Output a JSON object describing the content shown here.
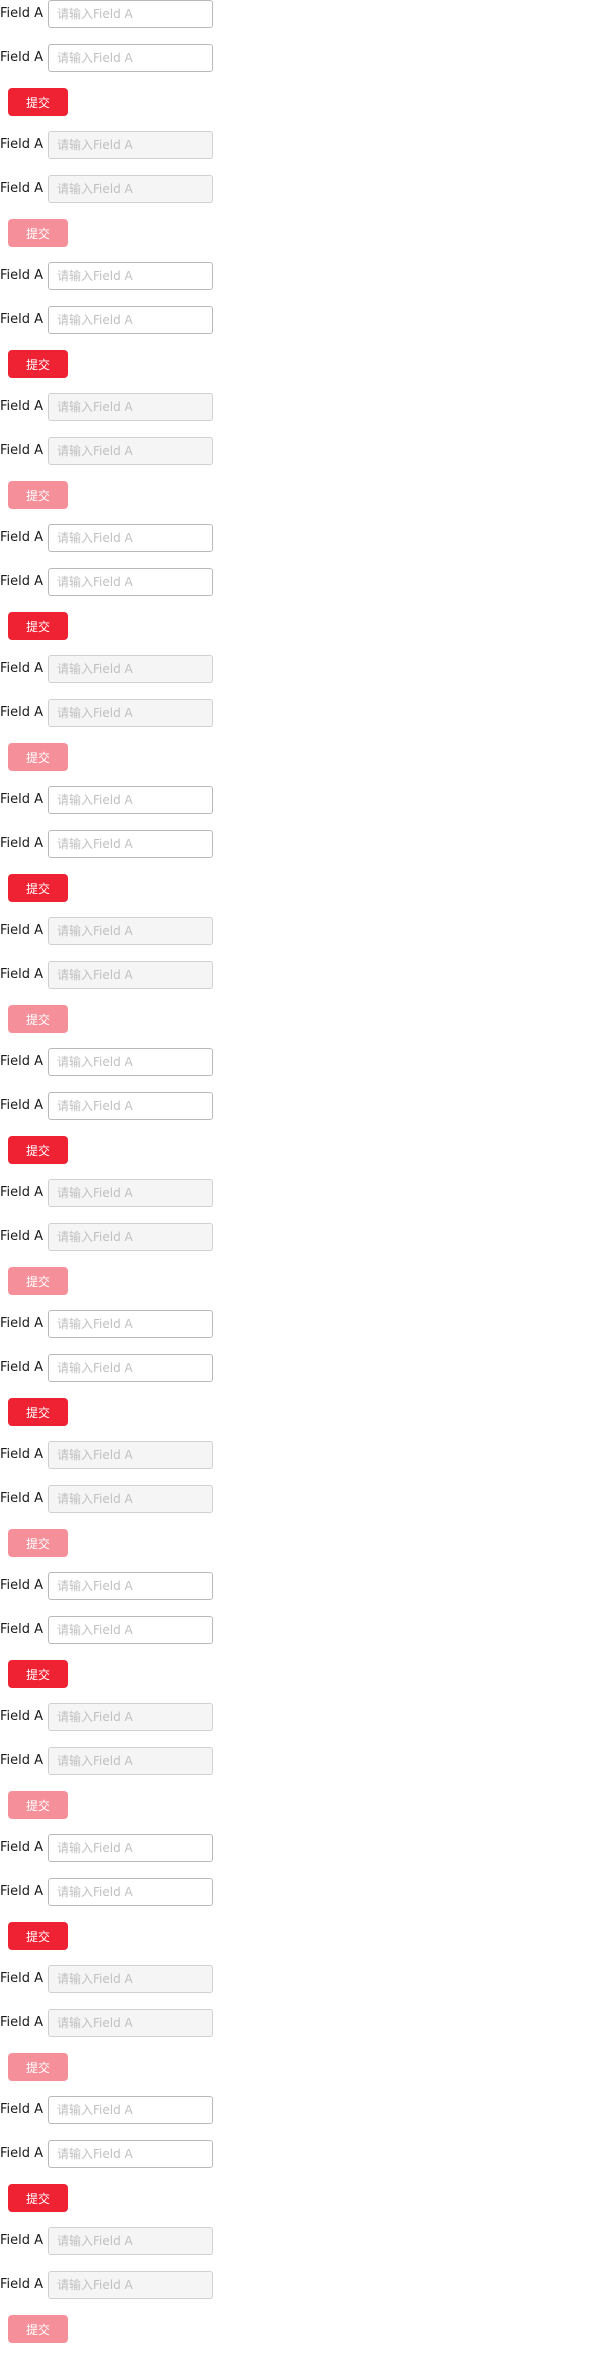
{
  "accent_color": "#ee2233",
  "accent_disabled_color": "#f5909a",
  "forms": [
    {
      "disabled": false,
      "fields": [
        {
          "label": "Field A",
          "placeholder": "请输入Field A"
        },
        {
          "label": "Field A",
          "placeholder": "请输入Field A"
        }
      ],
      "submit_label": "提交"
    },
    {
      "disabled": true,
      "fields": [
        {
          "label": "Field A",
          "placeholder": "请输入Field A"
        },
        {
          "label": "Field A",
          "placeholder": "请输入Field A"
        }
      ],
      "submit_label": "提交"
    },
    {
      "disabled": false,
      "fields": [
        {
          "label": "Field A",
          "placeholder": "请输入Field A"
        },
        {
          "label": "Field A",
          "placeholder": "请输入Field A"
        }
      ],
      "submit_label": "提交"
    },
    {
      "disabled": true,
      "fields": [
        {
          "label": "Field A",
          "placeholder": "请输入Field A"
        },
        {
          "label": "Field A",
          "placeholder": "请输入Field A"
        }
      ],
      "submit_label": "提交"
    },
    {
      "disabled": false,
      "fields": [
        {
          "label": "Field A",
          "placeholder": "请输入Field A"
        },
        {
          "label": "Field A",
          "placeholder": "请输入Field A"
        }
      ],
      "submit_label": "提交"
    },
    {
      "disabled": true,
      "fields": [
        {
          "label": "Field A",
          "placeholder": "请输入Field A"
        },
        {
          "label": "Field A",
          "placeholder": "请输入Field A"
        }
      ],
      "submit_label": "提交"
    },
    {
      "disabled": false,
      "fields": [
        {
          "label": "Field A",
          "placeholder": "请输入Field A"
        },
        {
          "label": "Field A",
          "placeholder": "请输入Field A"
        }
      ],
      "submit_label": "提交"
    },
    {
      "disabled": true,
      "fields": [
        {
          "label": "Field A",
          "placeholder": "请输入Field A"
        },
        {
          "label": "Field A",
          "placeholder": "请输入Field A"
        }
      ],
      "submit_label": "提交"
    },
    {
      "disabled": false,
      "fields": [
        {
          "label": "Field A",
          "placeholder": "请输入Field A"
        },
        {
          "label": "Field A",
          "placeholder": "请输入Field A"
        }
      ],
      "submit_label": "提交"
    },
    {
      "disabled": true,
      "fields": [
        {
          "label": "Field A",
          "placeholder": "请输入Field A"
        },
        {
          "label": "Field A",
          "placeholder": "请输入Field A"
        }
      ],
      "submit_label": "提交"
    },
    {
      "disabled": false,
      "fields": [
        {
          "label": "Field A",
          "placeholder": "请输入Field A"
        },
        {
          "label": "Field A",
          "placeholder": "请输入Field A"
        }
      ],
      "submit_label": "提交"
    },
    {
      "disabled": true,
      "fields": [
        {
          "label": "Field A",
          "placeholder": "请输入Field A"
        },
        {
          "label": "Field A",
          "placeholder": "请输入Field A"
        }
      ],
      "submit_label": "提交"
    },
    {
      "disabled": false,
      "fields": [
        {
          "label": "Field A",
          "placeholder": "请输入Field A"
        },
        {
          "label": "Field A",
          "placeholder": "请输入Field A"
        }
      ],
      "submit_label": "提交"
    },
    {
      "disabled": true,
      "fields": [
        {
          "label": "Field A",
          "placeholder": "请输入Field A"
        },
        {
          "label": "Field A",
          "placeholder": "请输入Field A"
        }
      ],
      "submit_label": "提交"
    },
    {
      "disabled": false,
      "fields": [
        {
          "label": "Field A",
          "placeholder": "请输入Field A"
        },
        {
          "label": "Field A",
          "placeholder": "请输入Field A"
        }
      ],
      "submit_label": "提交"
    },
    {
      "disabled": true,
      "fields": [
        {
          "label": "Field A",
          "placeholder": "请输入Field A"
        },
        {
          "label": "Field A",
          "placeholder": "请输入Field A"
        }
      ],
      "submit_label": "提交"
    },
    {
      "disabled": false,
      "fields": [
        {
          "label": "Field A",
          "placeholder": "请输入Field A"
        },
        {
          "label": "Field A",
          "placeholder": "请输入Field A"
        }
      ],
      "submit_label": "提交"
    },
    {
      "disabled": true,
      "fields": [
        {
          "label": "Field A",
          "placeholder": "请输入Field A"
        },
        {
          "label": "Field A",
          "placeholder": "请输入Field A"
        }
      ],
      "submit_label": "提交"
    }
  ]
}
